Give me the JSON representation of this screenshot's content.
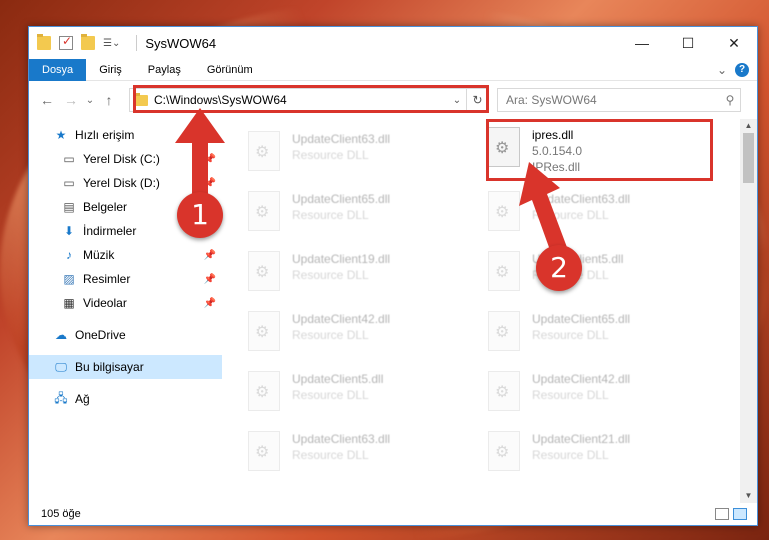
{
  "window": {
    "title": "SysWOW64",
    "minimize": "—",
    "maximize": "☐",
    "close": "✕"
  },
  "ribbon": {
    "tabs": [
      "Dosya",
      "Giriş",
      "Paylaş",
      "Görünüm"
    ],
    "expand": "⌄",
    "help": "?"
  },
  "nav": {
    "back": "←",
    "forward": "→",
    "recent": "⌄",
    "up": "↑",
    "address": "C:\\Windows\\SysWOW64",
    "dropdown": "⌄",
    "refresh": "↻",
    "search_placeholder": "Ara: SysWOW64",
    "search_icon": "⚲"
  },
  "sidebar": {
    "quick_access": "Hızlı erişim",
    "items": [
      {
        "label": "Yerel Disk (C:)",
        "icon": "drive-icon",
        "pinned": true
      },
      {
        "label": "Yerel Disk (D:)",
        "icon": "drive-icon",
        "pinned": true
      },
      {
        "label": "Belgeler",
        "icon": "documents-icon",
        "pinned": true
      },
      {
        "label": "İndirmeler",
        "icon": "download-icon",
        "pinned": true
      },
      {
        "label": "Müzik",
        "icon": "music-icon",
        "pinned": true
      },
      {
        "label": "Resimler",
        "icon": "pictures-icon",
        "pinned": true
      },
      {
        "label": "Videolar",
        "icon": "videos-icon",
        "pinned": true
      }
    ],
    "onedrive": "OneDrive",
    "this_pc": "Bu bilgisayar",
    "network": "Ağ"
  },
  "files": {
    "featured": {
      "name": "ipres.dll",
      "version": "5.0.154.0",
      "description": "IPRes.dll"
    },
    "left_column": [
      {
        "name": "UpdateClient63.dll",
        "type": "Resource DLL"
      },
      {
        "name": "UpdateClient65.dll",
        "type": "Resource DLL"
      },
      {
        "name": "UpdateClient19.dll",
        "type": "Resource DLL"
      },
      {
        "name": "UpdateClient42.dll",
        "type": "Resource DLL"
      },
      {
        "name": "UpdateClient5.dll",
        "type": "Resource DLL"
      },
      {
        "name": "UpdateClient63.dll",
        "type": "Resource DLL"
      }
    ],
    "right_column": [
      {
        "name": "UpdateClient63.dll",
        "type": "Resource DLL"
      },
      {
        "name": "UpdateClient5.dll",
        "type": "Resource DLL"
      },
      {
        "name": "UpdateClient65.dll",
        "type": "Resource DLL"
      },
      {
        "name": "UpdateClient42.dll",
        "type": "Resource DLL"
      },
      {
        "name": "UpdateClient21.dll",
        "type": "Resource DLL"
      }
    ]
  },
  "status": {
    "count": "105 öğe"
  },
  "annotations": {
    "badge1": "1",
    "badge2": "2",
    "color": "#d9342b"
  }
}
